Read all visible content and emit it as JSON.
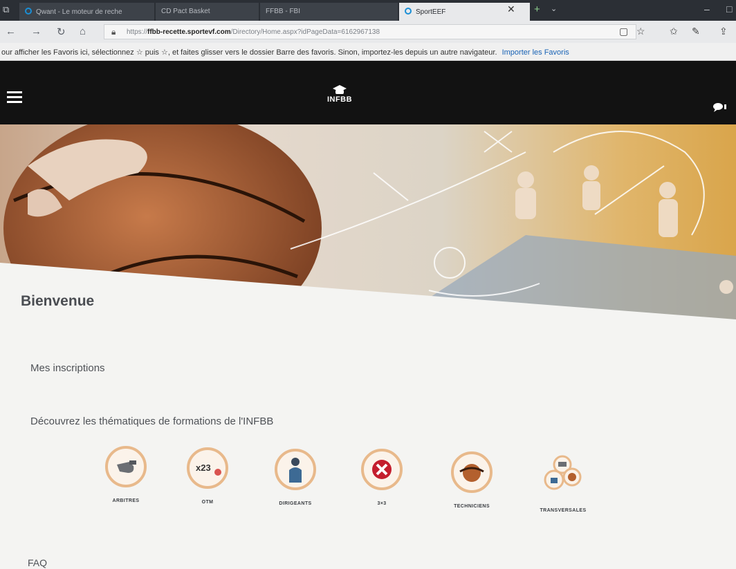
{
  "browser": {
    "tabs": [
      {
        "label": "Qwant - Le moteur de reche"
      },
      {
        "label": "CD Pact Basket"
      },
      {
        "label": "FFBB - FBI"
      },
      {
        "label": "SportEEF"
      }
    ],
    "url_prefix": "https://",
    "url_host": "ffbb-recette.sportevf.com",
    "url_path": "/Directory/Home.aspx?idPageData=6162967138",
    "favorites_hint": "our afficher les Favoris ici, sélectionnez ☆ puis ☆, et faites glisser vers le dossier Barre des favoris. Sinon, importez-les depuis un autre navigateur.",
    "favorites_import_link": "Importer les Favoris"
  },
  "site": {
    "logo_text": "INFBB",
    "welcome": "Bienvenue",
    "sections": {
      "inscriptions": "Mes inscriptions",
      "discover": "Découvrez les thématiques de formations de l'INFBB",
      "faq": "FAQ"
    },
    "themes": [
      {
        "label": "ARBITRES",
        "icon": "whistle-icon"
      },
      {
        "label": "OTM",
        "icon": "scoreboard-numbers-icon"
      },
      {
        "label": "DIRIGEANTS",
        "icon": "manager-icon"
      },
      {
        "label": "3×3",
        "icon": "three-x-three-icon"
      },
      {
        "label": "TECHNICIENS",
        "icon": "basketball-hands-icon"
      },
      {
        "label": "TRANSVERSALES",
        "icon": "mixed-themes-icon"
      }
    ]
  },
  "colors": {
    "header_bg": "#121212",
    "theme_ring": "#e8b98b",
    "accent_link": "#1862b5"
  }
}
